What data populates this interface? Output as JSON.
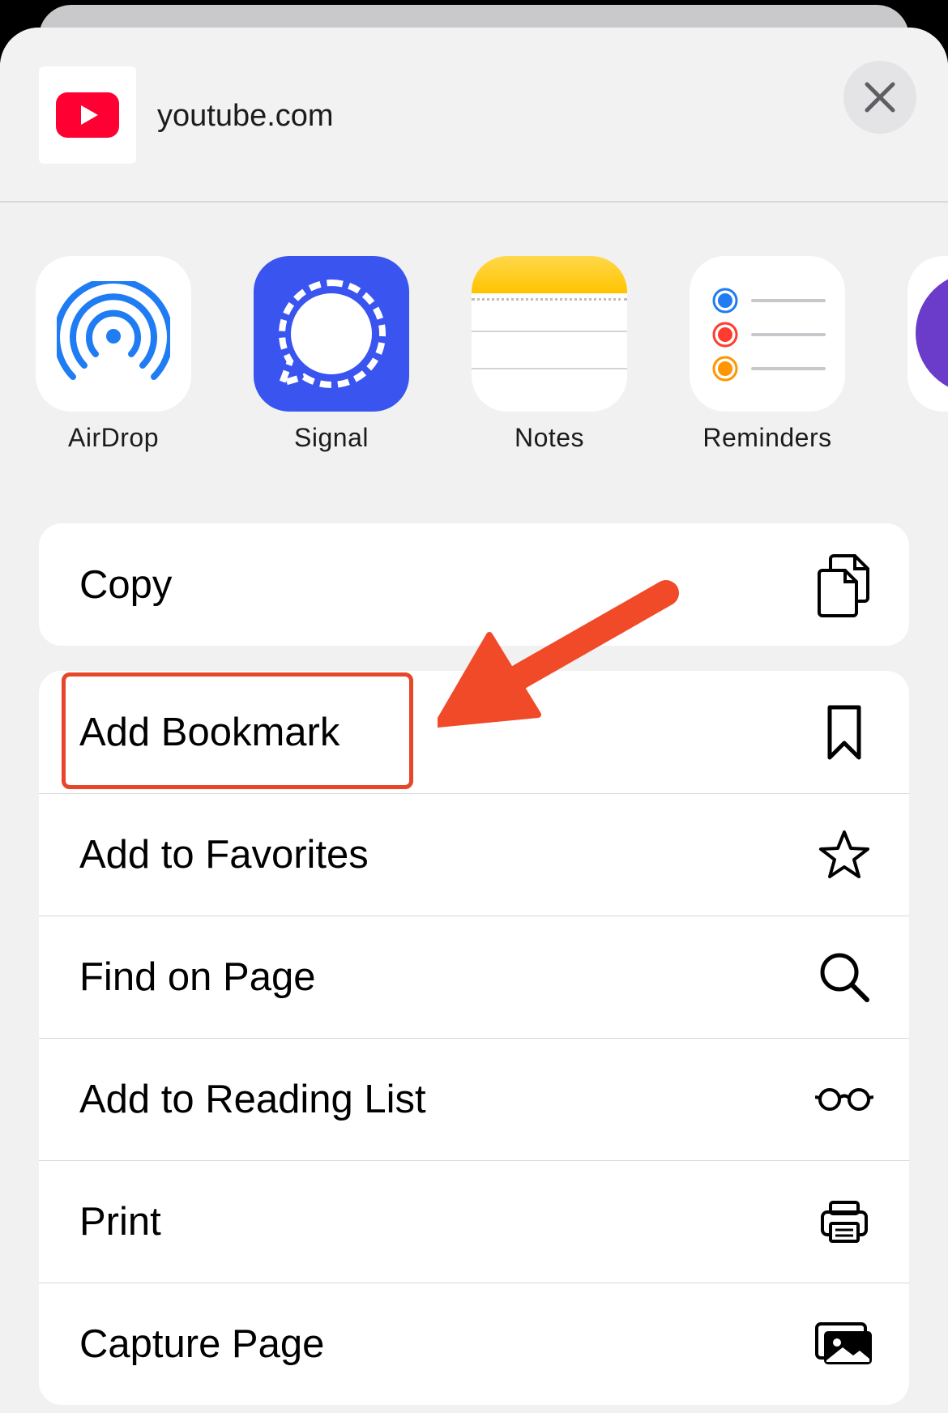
{
  "header": {
    "site_name": "youtube.com",
    "close_icon": "close-icon"
  },
  "apps": [
    {
      "label": "AirDrop",
      "icon": "airdrop-icon"
    },
    {
      "label": "Signal",
      "icon": "signal-icon"
    },
    {
      "label": "Notes",
      "icon": "notes-icon"
    },
    {
      "label": "Reminders",
      "icon": "reminders-icon"
    }
  ],
  "actions_top": [
    {
      "label": "Copy",
      "icon": "copy-icon"
    }
  ],
  "actions": [
    {
      "label": "Add Bookmark",
      "icon": "bookmark-icon"
    },
    {
      "label": "Add to Favorites",
      "icon": "star-icon"
    },
    {
      "label": "Find on Page",
      "icon": "search-icon"
    },
    {
      "label": "Add to Reading List",
      "icon": "glasses-icon"
    },
    {
      "label": "Print",
      "icon": "printer-icon"
    },
    {
      "label": "Capture Page",
      "icon": "photos-icon"
    }
  ],
  "colors": {
    "youtube_red": "#ff0033",
    "airdrop_blue": "#1f7cf2",
    "signal_blue": "#3a54f0",
    "notes_yellow": "#ffcc10",
    "annotation_red": "#e8462b"
  }
}
